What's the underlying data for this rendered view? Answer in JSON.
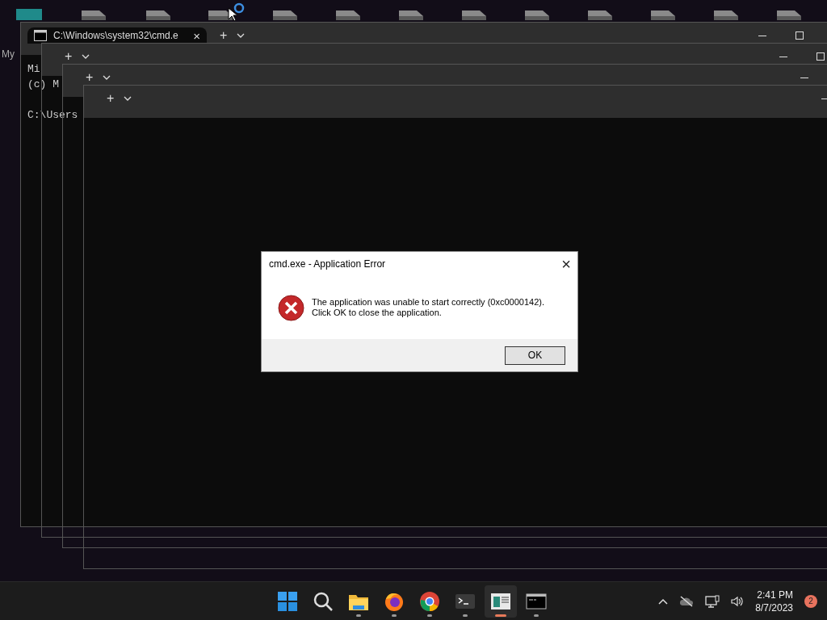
{
  "desktop": {
    "label": "My"
  },
  "windows": [
    {
      "tab": {
        "title": "C:\\Windows\\system32\\cmd.e",
        "close": "×"
      },
      "new_tab": "+",
      "lines": [
        "Mi",
        "(c) M"
      ],
      "prompt": "C:\\Users"
    },
    {
      "new_tab": "+"
    },
    {
      "new_tab": "+"
    },
    {
      "new_tab": "+"
    }
  ],
  "dialog": {
    "title": "cmd.exe - Application Error",
    "close": "×",
    "message": [
      "The application was unable to start correctly (0xc0000142).",
      "Click OK to close the application."
    ],
    "button": "OK"
  },
  "taskbar": {
    "apps": [
      {
        "kind": "start",
        "running": false,
        "selected": false
      },
      {
        "kind": "search",
        "running": false,
        "selected": false
      },
      {
        "kind": "folder",
        "running": true,
        "selected": false
      },
      {
        "kind": "firefox",
        "running": true,
        "selected": false
      },
      {
        "kind": "chrome",
        "running": true,
        "selected": false
      },
      {
        "kind": "terminal",
        "running": true,
        "selected": false
      },
      {
        "kind": "window",
        "running": true,
        "selected": true
      },
      {
        "kind": "cmd",
        "running": true,
        "selected": false
      }
    ],
    "time": "2:41 PM",
    "date": "8/7/2023",
    "notifications": "2"
  }
}
